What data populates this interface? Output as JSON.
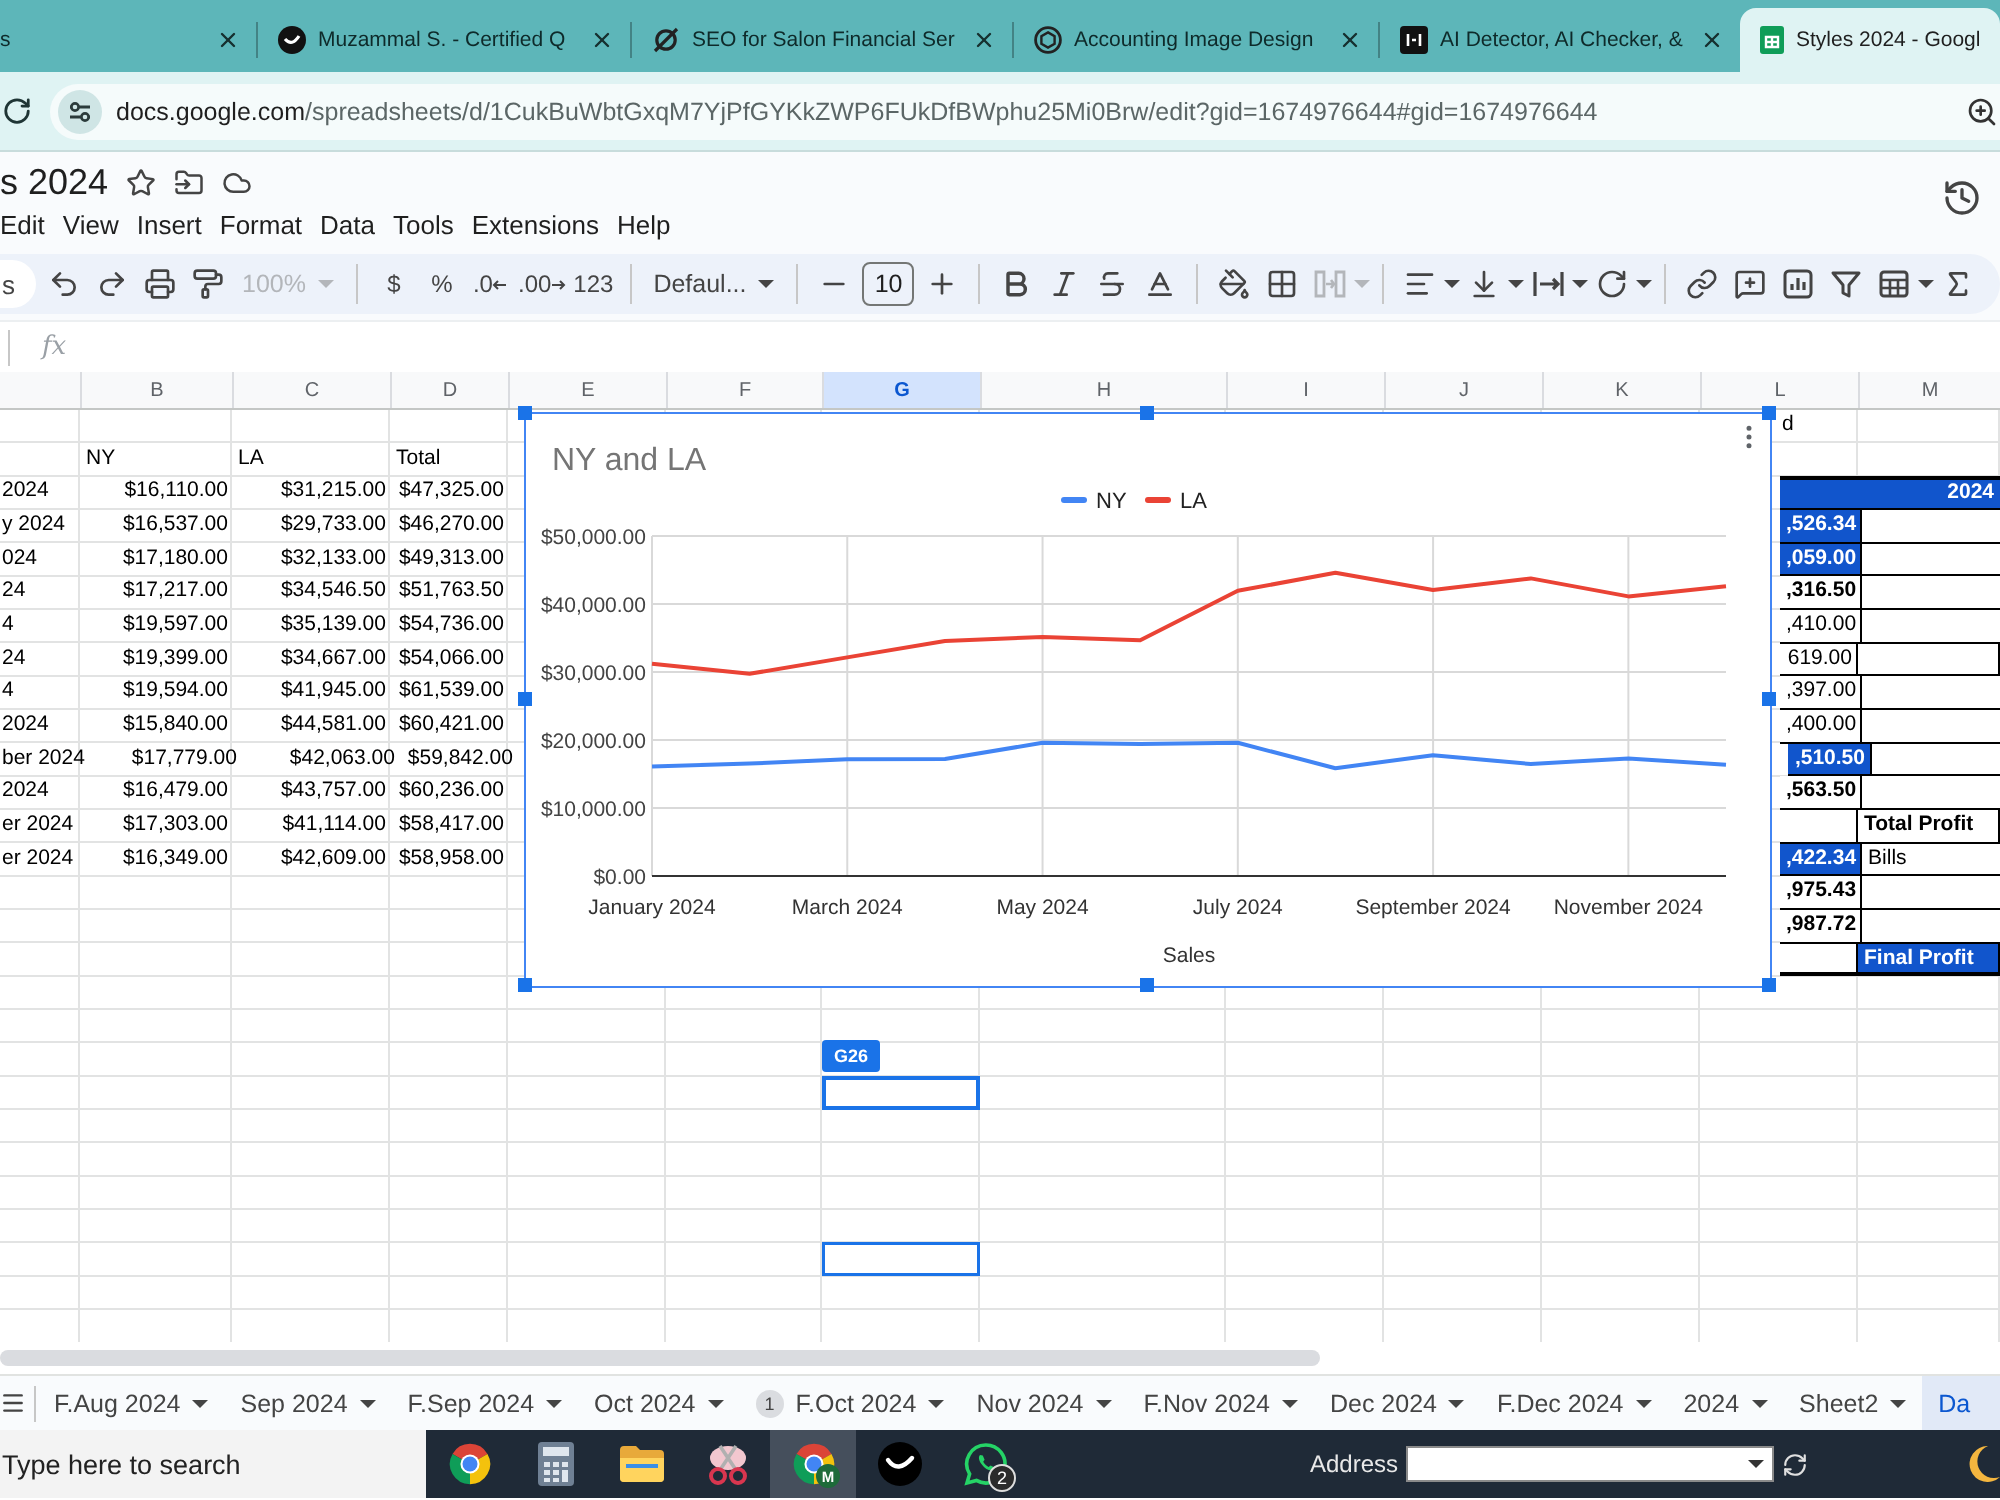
{
  "browser": {
    "tabs": [
      {
        "title": "s",
        "kind": "plain",
        "selected": false
      },
      {
        "title": "Muzammal S. - Certified Q",
        "kind": "logo",
        "selected": false
      },
      {
        "title": "SEO for Salon Financial Ser",
        "kind": "slash",
        "selected": false
      },
      {
        "title": "Accounting Image Design",
        "kind": "knot",
        "selected": false
      },
      {
        "title": "AI Detector, AI Checker, &",
        "kind": "square",
        "selected": false
      },
      {
        "title": "Styles 2024 - Googl",
        "kind": "sheet",
        "selected": true
      }
    ],
    "address": {
      "host": "docs.google.com",
      "path": "/spreadsheets/d/1CukBuWbtGxqM7YjPfGYKkZWP6FUkDfBWphu25Mi0Brw/edit?gid=1674976644#gid=1674976644"
    }
  },
  "document": {
    "title": "s 2024",
    "menu": [
      "Edit",
      "View",
      "Insert",
      "Format",
      "Data",
      "Tools",
      "Extensions",
      "Help"
    ]
  },
  "toolbar": {
    "search": {
      "placeholder": "s"
    },
    "zoom": {
      "value": "100%",
      "disabled": true
    },
    "formats": [
      {
        "label": "$",
        "kind": "plain"
      },
      {
        "label": "%",
        "kind": "plain"
      },
      {
        "label": ".0",
        "kind": "decrease"
      },
      {
        "label": ".00",
        "kind": "increase"
      },
      {
        "label": "123",
        "kind": "plain"
      }
    ],
    "font": "Defaul...",
    "font_size": "10",
    "merge_disabled": true
  },
  "formula_bar": {
    "function_label": "fx"
  },
  "sheet": {
    "columns": [
      {
        "label": "B",
        "selected": false
      },
      {
        "label": "C",
        "selected": false
      },
      {
        "label": "D",
        "selected": false
      },
      {
        "label": "E",
        "selected": false
      },
      {
        "label": "F",
        "selected": false
      },
      {
        "label": "G",
        "selected": true
      },
      {
        "label": "H",
        "selected": false
      },
      {
        "label": "I",
        "selected": false
      },
      {
        "label": "J",
        "selected": false
      },
      {
        "label": "K",
        "selected": false
      },
      {
        "label": "L",
        "selected": false
      },
      {
        "label": "M",
        "selected": false
      }
    ],
    "table": {
      "headers": [
        "NY",
        "LA",
        "Total"
      ],
      "rows": [
        [
          "2024",
          "$16,110.00",
          "$31,215.00",
          "$47,325.00"
        ],
        [
          "y 2024",
          "$16,537.00",
          "$29,733.00",
          "$46,270.00"
        ],
        [
          "024",
          "$17,180.00",
          "$32,133.00",
          "$49,313.00"
        ],
        [
          "24",
          "$17,217.00",
          "$34,546.50",
          "$51,763.50"
        ],
        [
          "4",
          "$19,597.00",
          "$35,139.00",
          "$54,736.00"
        ],
        [
          "24",
          "$19,399.00",
          "$34,667.00",
          "$54,066.00"
        ],
        [
          "4",
          "$19,594.00",
          "$41,945.00",
          "$61,539.00"
        ],
        [
          "2024",
          "$15,840.00",
          "$44,581.00",
          "$60,421.00"
        ],
        [
          "ber 2024",
          "$17,779.00",
          "$42,063.00",
          "$59,842.00"
        ],
        [
          "2024",
          "$16,479.00",
          "$43,757.00",
          "$60,236.00"
        ],
        [
          "er 2024",
          "$17,303.00",
          "$41,114.00",
          "$58,417.00"
        ],
        [
          "er 2024",
          "$16,349.00",
          "$42,609.00",
          "$58,958.00"
        ]
      ]
    },
    "chart": {
      "chart_data": [
        {
          "type": "line",
          "title": "NY and LA",
          "xlabel": "Sales",
          "categories": [
            "January 2024",
            null,
            "March 2024",
            null,
            "May 2024",
            null,
            "July 2024",
            null,
            "September 2024",
            null,
            "November 2024",
            null
          ],
          "series": [
            {
              "name": "NY",
              "color": "#4285f4",
              "values": [
                16110,
                16537,
                17180,
                17217,
                19597,
                19399,
                19594,
                15840,
                17779,
                16479,
                17303,
                16349
              ]
            },
            {
              "name": "LA",
              "color": "#ea4335",
              "values": [
                31215,
                29733,
                32133,
                34546.5,
                35139,
                34667,
                41945,
                44581,
                42063,
                43757,
                41114,
                42609
              ]
            }
          ],
          "ylim": [
            0,
            50000
          ],
          "yticks": [
            {
              "value": 0,
              "label": "$0.00"
            },
            {
              "value": 10000,
              "label": "$10,000.00"
            },
            {
              "value": 20000,
              "label": "$20,000.00"
            },
            {
              "value": 30000,
              "label": "$30,000.00"
            },
            {
              "value": 40000,
              "label": "$40,000.00"
            },
            {
              "value": 50000,
              "label": "$50,000.00"
            }
          ],
          "legend": "top",
          "grid": true
        }
      ]
    },
    "summary": {
      "fragment": "d",
      "band": "2024",
      "rows": [
        {
          "column_l": {
            "text": ",526.34",
            "kind": "highlight"
          }
        },
        {
          "column_l": {
            "text": ",059.00",
            "kind": "highlight"
          }
        },
        {
          "column_l": {
            "text": ",316.50",
            "kind": "bold"
          }
        },
        {
          "column_l": {
            "text": ",410.00",
            "kind": "plain"
          }
        },
        {
          "column_l": {
            "text": "619.00",
            "kind": "plain"
          }
        },
        {
          "column_l": {
            "text": ",397.00",
            "kind": "plain"
          }
        },
        {
          "column_l": {
            "text": ",400.00",
            "kind": "plain"
          }
        },
        {
          "column_l": {
            "text": ",510.50",
            "kind": "highlight"
          }
        },
        {
          "column_l": {
            "text": ",563.50",
            "kind": "bold"
          }
        },
        {
          "column_m": {
            "text": "Total Profit",
            "kind": "bold"
          }
        },
        {
          "column_l": {
            "text": ",422.34",
            "kind": "highlight"
          },
          "column_m": {
            "text": "Bills",
            "kind": "plain"
          }
        },
        {
          "column_l": {
            "text": ",975.43",
            "kind": "bold"
          }
        },
        {
          "column_l": {
            "text": ",987.72",
            "kind": "bold"
          }
        },
        {
          "column_m": {
            "text": "Final Profit",
            "kind": "highlight"
          }
        }
      ]
    },
    "selection": {
      "tag": "G26",
      "extra_outline": true
    }
  },
  "sheet_tabs": [
    {
      "label": "F.Aug 2024",
      "selected": false
    },
    {
      "label": "Sep 2024",
      "selected": false
    },
    {
      "label": "F.Sep 2024",
      "selected": false
    },
    {
      "label": "Oct 2024",
      "selected": false
    },
    {
      "label": "F.Oct 2024",
      "badge": "1",
      "selected": false
    },
    {
      "label": "Nov 2024",
      "selected": false
    },
    {
      "label": "F.Nov 2024",
      "selected": false
    },
    {
      "label": "Dec 2024",
      "selected": false
    },
    {
      "label": "F.Dec 2024",
      "selected": false
    },
    {
      "label": "2024",
      "selected": false
    },
    {
      "label": "Sheet2",
      "selected": false
    },
    {
      "label": "Da",
      "selected": true
    }
  ],
  "taskbar": {
    "search": {
      "placeholder": "Type here to search"
    },
    "apps": [
      {
        "kind": "browser",
        "selected": false
      },
      {
        "kind": "calculator",
        "selected": false
      },
      {
        "kind": "folder",
        "selected": false
      },
      {
        "kind": "scissors",
        "selected": false
      },
      {
        "kind": "browser",
        "avatar": "M",
        "selected": true
      },
      {
        "kind": "logo",
        "selected": false
      },
      {
        "kind": "chat",
        "badge": "2",
        "selected": false
      }
    ],
    "address": {
      "label": "Address"
    }
  }
}
